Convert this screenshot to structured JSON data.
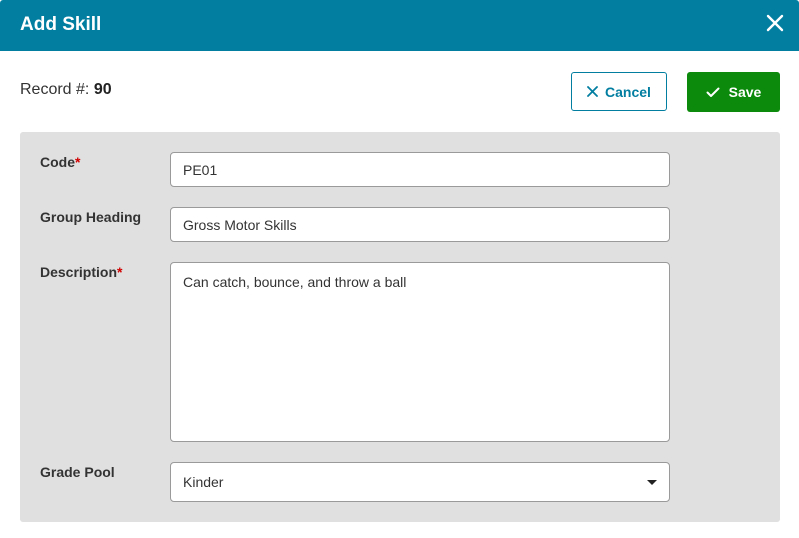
{
  "dialog": {
    "title": "Add Skill",
    "close_icon": "close-icon"
  },
  "record": {
    "label": "Record #:",
    "value": "90"
  },
  "actions": {
    "cancel_label": "Cancel",
    "cancel_icon": "close-icon",
    "save_label": "Save",
    "save_icon": "check-icon"
  },
  "form": {
    "code": {
      "label": "Code",
      "required_marker": "*",
      "value": "PE01"
    },
    "group_heading": {
      "label": "Group Heading",
      "value": "Gross Motor Skills"
    },
    "description": {
      "label": "Description",
      "required_marker": "*",
      "value": "Can catch, bounce, and throw a ball"
    },
    "grade_pool": {
      "label": "Grade Pool",
      "value": "Kinder",
      "icon": "caret-down-icon"
    }
  },
  "colors": {
    "header": "#027ea1",
    "save_button": "#0b8a0b",
    "panel": "#e0e0e0",
    "required": "#d10000"
  }
}
